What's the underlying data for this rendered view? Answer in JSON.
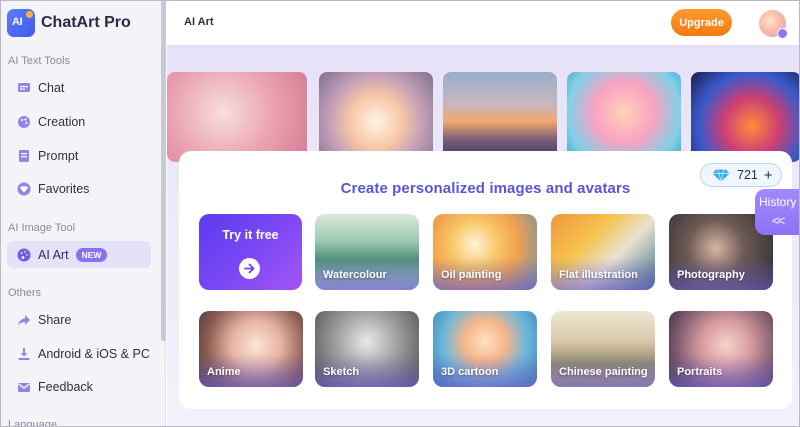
{
  "app": {
    "name": "ChatArt Pro",
    "logo_text": "AI"
  },
  "sidebar": {
    "sections": [
      {
        "label": "AI Text Tools"
      },
      {
        "label": "AI Image Tool"
      },
      {
        "label": "Others"
      },
      {
        "label": "Language"
      }
    ],
    "items": [
      {
        "label": "Chat",
        "icon": "chat-icon"
      },
      {
        "label": "Creation",
        "icon": "palette-icon"
      },
      {
        "label": "Prompt",
        "icon": "prompt-icon"
      },
      {
        "label": "Favorites",
        "icon": "heart-icon"
      },
      {
        "label": "AI Art",
        "icon": "paint-palette-icon",
        "badge": "NEW",
        "active": true
      },
      {
        "label": "Share",
        "icon": "share-arrow-icon"
      },
      {
        "label": "Android & iOS & PC",
        "icon": "download-icon"
      },
      {
        "label": "Feedback",
        "icon": "mail-icon"
      }
    ]
  },
  "header": {
    "title": "AI Art",
    "upgrade_label": "Upgrade"
  },
  "main": {
    "panel_title": "Create personalized images and avatars",
    "credits": {
      "value": "721",
      "plus": "+"
    },
    "try_label": "Try it free",
    "styles": [
      {
        "label": "Watercolour"
      },
      {
        "label": "Oil painting"
      },
      {
        "label": "Flat illustration"
      },
      {
        "label": "Photography"
      },
      {
        "label": "Anime"
      },
      {
        "label": "Sketch"
      },
      {
        "label": "3D cartoon"
      },
      {
        "label": "Chinese painting"
      },
      {
        "label": "Portraits"
      }
    ],
    "history_label": "History",
    "history_chevron": "<<"
  },
  "colors": {
    "accent": "#5a54d8",
    "upgrade": "#f58a1f",
    "active_bg": "#e4e2f6",
    "badge": "#8b70f2"
  }
}
